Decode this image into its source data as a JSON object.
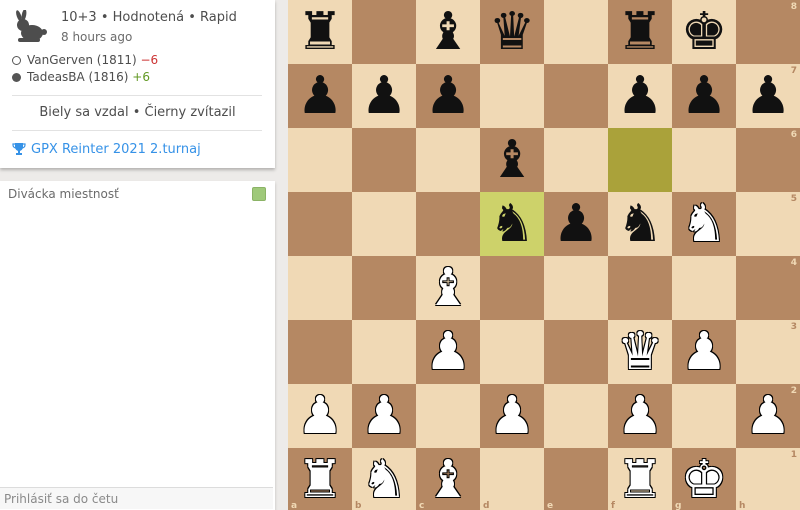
{
  "game": {
    "meta": "10+3 • Hodnotená • Rapid",
    "time_ago": "8 hours ago",
    "players": [
      {
        "name": "VanGerven (1811)",
        "delta": "−6",
        "side": "white"
      },
      {
        "name": "TadeasBA (1816)",
        "delta": "+6",
        "side": "black"
      }
    ],
    "result": "Biely sa vzdal • Čierny zvítazil",
    "tournament": "GPX Reinter 2021 2.turnaj"
  },
  "chat": {
    "title": "Divácka miestnosť",
    "input_placeholder": "Prihlásiť sa do četu"
  },
  "icons": {
    "mode": "rabbit-icon",
    "tournament": "trophy-icon",
    "chat_toggle": "checkbox-icon"
  },
  "colors": {
    "light_square": "#f0d9b5",
    "dark_square": "#b58863",
    "last_move_light": "#cdd26a",
    "last_move_dark": "#aaa23a",
    "link": "#3692e7",
    "rating_loss": "#cc3333",
    "rating_gain": "#629924"
  },
  "board": {
    "orientation": "white",
    "ranks": [
      "8",
      "7",
      "6",
      "5",
      "4",
      "3",
      "2",
      "1"
    ],
    "files": [
      "a",
      "b",
      "c",
      "d",
      "e",
      "f",
      "g",
      "h"
    ],
    "last_move": [
      "f6",
      "d5"
    ],
    "position": [
      [
        "bR",
        "",
        "bB",
        "bQ",
        "",
        "bR",
        "bK",
        ""
      ],
      [
        "bP",
        "bP",
        "bP",
        "",
        "",
        "bP",
        "bP",
        "bP"
      ],
      [
        "",
        "",
        "",
        "bB",
        "",
        "",
        "",
        ""
      ],
      [
        "",
        "",
        "",
        "bN",
        "bP",
        "bN",
        "wN",
        ""
      ],
      [
        "",
        "",
        "wB",
        "",
        "",
        "",
        "",
        ""
      ],
      [
        "",
        "",
        "wP",
        "",
        "",
        "wQ",
        "wP",
        ""
      ],
      [
        "wP",
        "wP",
        "",
        "wP",
        "",
        "wP",
        "",
        "wP"
      ],
      [
        "wR",
        "wN",
        "wB",
        "",
        "",
        "wR",
        "wK",
        ""
      ]
    ]
  }
}
